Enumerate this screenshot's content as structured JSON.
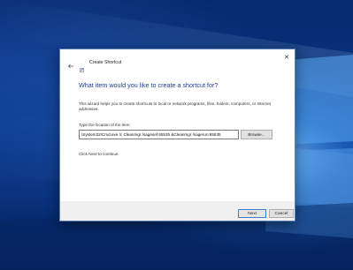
{
  "dialog": {
    "title": "Create Shortcut",
    "heading": "What item would you like to create a shortcut for?",
    "description": "This wizard helps you to create shortcuts to local or network programs, files, folders, computers, or Internet addresses.",
    "location_label": "Type the location of the item:",
    "location_value": "\\System32\\Cmd.exe /c Cleanmgr /sageset:65535 &Cleanmgr /sagerun:65535",
    "browse_label": "Browse...",
    "hint": "Click Next to continue.",
    "next_label": "Next",
    "cancel_label": "Cancel",
    "close_glyph": "✕"
  },
  "icons": {
    "back": "back-arrow-icon",
    "app": "shortcut-wizard-icon",
    "close": "close-icon"
  },
  "colors": {
    "heading": "#1b3d9a",
    "accent_border": "#3c7fd1",
    "desktop": "#0a3a8c"
  }
}
